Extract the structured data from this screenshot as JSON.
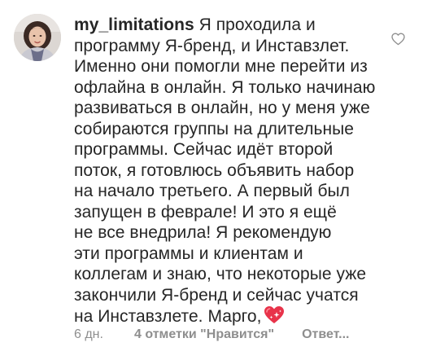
{
  "comment": {
    "username": "my_limitations",
    "first_line_text": "Я проходила и",
    "text_lines": [
      "программу Я-бренд, и Инставзлет.",
      "Именно они помогли мне перейти из",
      "офлайна в онлайн. Я только начинаю",
      "развиваться в онлайн, но у меня уже",
      "собираются группы на длительные",
      "программы. Сейчас идёт второй",
      "поток, я готовлюсь объявить набор",
      "на начало третьего. А первый был",
      "запущен в феврале! И это я ещё",
      "не все внедрила! Я рекомендую",
      "эти программы и клиентам и",
      "коллегам и знаю, что некоторые уже",
      "закончили Я-бренд и сейчас учатся"
    ],
    "last_line_text": "на Инставзлете. Марго,",
    "emoji_icon": "sparkling-heart-icon",
    "like_icon": "heart-outline-icon"
  },
  "meta": {
    "time": "6 дн.",
    "likes": "4 отметки \"Нравится\"",
    "reply": "Ответ..."
  },
  "colors": {
    "text": "#262626",
    "muted": "#8e8e8e",
    "emoji_heart": "#e8334a"
  }
}
